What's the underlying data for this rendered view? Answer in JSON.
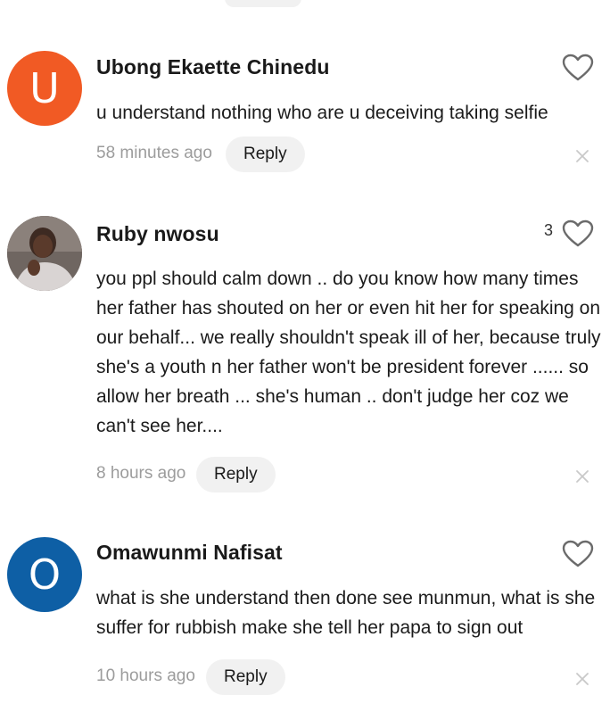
{
  "comments": [
    {
      "avatar_letter": "U",
      "avatar_color": "#f15a24",
      "author": "Ubong Ekaette Chinedu",
      "text": "u understand nothing who are u deceiving taking selfie",
      "time": "58 minutes ago",
      "reply_label": "Reply",
      "likes": ""
    },
    {
      "avatar_letter": "",
      "avatar_color": "#7a6c66",
      "author": "Ruby nwosu",
      "text": "you ppl should calm down .. do you know how many times her father has shouted on her or even hit her for speaking on our behalf... we really shouldn't speak ill of her, because truly she's a youth n her father won't be president forever ...... so allow her breath ... she's human .. don't judge her coz we can't see her....",
      "time": "8 hours ago",
      "reply_label": "Reply",
      "likes": "3"
    },
    {
      "avatar_letter": "O",
      "avatar_color": "#0e5fa5",
      "author": "Omawunmi Nafisat",
      "text": "what is she understand then done see munmun, what is she suffer for rubbish make she tell her papa to sign out",
      "time": "10 hours ago",
      "reply_label": "Reply",
      "likes": ""
    }
  ],
  "icons": {
    "like": "heart-outline-icon",
    "dismiss": "close-icon"
  }
}
